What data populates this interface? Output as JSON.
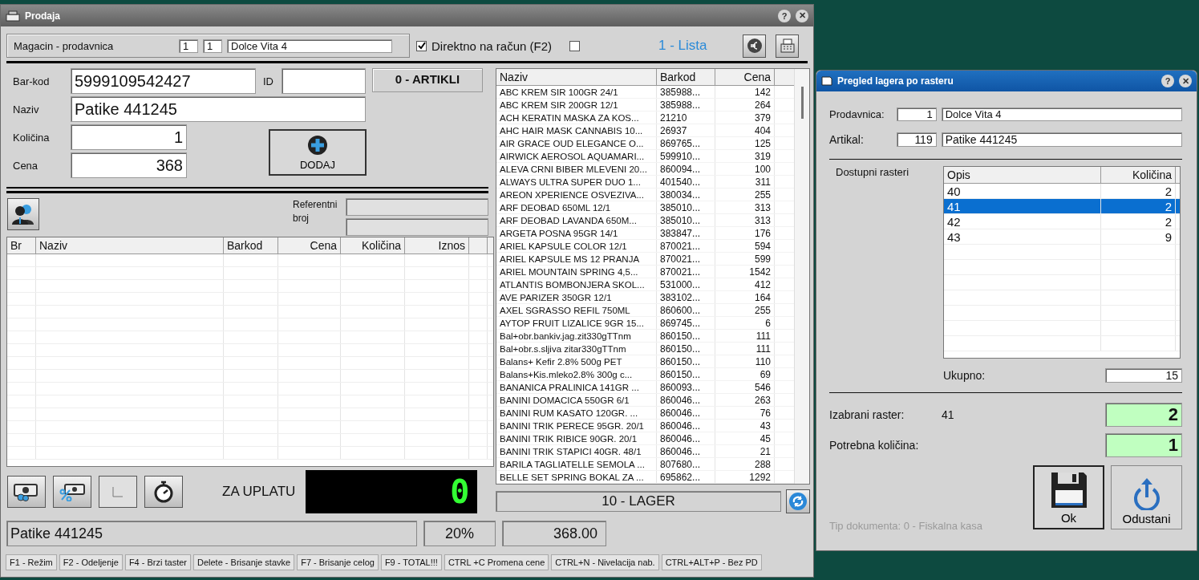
{
  "main_window": {
    "title": "Prodaja",
    "help": "?",
    "close": "✕"
  },
  "header": {
    "label": "Magacin - prodavnica",
    "field_1": "1",
    "field_2": "1",
    "store_name": "Dolce Vita 4",
    "direct_checkbox": {
      "label": "Direktno na račun (F2)",
      "checked": true
    },
    "extra_checkbox": {
      "checked": false
    },
    "list_label": "1 - Lista"
  },
  "form": {
    "barcode_label": "Bar-kod",
    "barcode": "5999109542427",
    "id_label": "ID",
    "article_count": "0 - ARTIKLI",
    "name_label": "Naziv",
    "name": "Patike 441245",
    "quantity_label": "Količina",
    "quantity": "1",
    "price_label": "Cena",
    "price": "368",
    "add_button": "DODAJ",
    "reference_label": "Referentni broj"
  },
  "cart": {
    "columns": [
      "Br",
      "Naziv",
      "Barkod",
      "Cena",
      "Količina",
      "Iznos"
    ]
  },
  "payment": {
    "label": "ZA UPLATU",
    "amount": "0"
  },
  "products": {
    "columns": [
      "Naziv",
      "Barkod",
      "Cena"
    ],
    "rows": [
      [
        "ABC KREM SIR 100GR 24/1",
        "385988...",
        "142"
      ],
      [
        "ABC KREM SIR 200GR 12/1",
        "385988...",
        "264"
      ],
      [
        "ACH KERATIN MASKA ZA KOS...",
        "21210",
        "379"
      ],
      [
        "AHC HAIR MASK CANNABIS 10...",
        "26937",
        "404"
      ],
      [
        "AIR GRACE OUD ELEGANCE O...",
        "869765...",
        "125"
      ],
      [
        "AIRWICK AEROSOL AQUAMARI...",
        "599910...",
        "319"
      ],
      [
        "ALEVA CRNI BIBER MLEVENI 20...",
        "860094...",
        "100"
      ],
      [
        "ALWAYS ULTRA SUPER DUO 1...",
        "401540...",
        "311"
      ],
      [
        "AREON XPERIENCE OSVEZIVA...",
        "380034...",
        "255"
      ],
      [
        "ARF DEOBAD 650ML 12/1",
        "385010...",
        "313"
      ],
      [
        "ARF DEOBAD LAVANDA 650M...",
        "385010...",
        "313"
      ],
      [
        "ARGETA POSNA 95GR 14/1",
        "383847...",
        "176"
      ],
      [
        "ARIEL KAPSULE COLOR 12/1",
        "870021...",
        "594"
      ],
      [
        "ARIEL KAPSULE MS 12 PRANJA",
        "870021...",
        "599"
      ],
      [
        "ARIEL MOUNTAIN SPRING 4,5...",
        "870021...",
        "1542"
      ],
      [
        "ATLANTIS BOMBONJERA SKOL...",
        "531000...",
        "412"
      ],
      [
        "AVE PARIZER 350GR 12/1",
        "383102...",
        "164"
      ],
      [
        "AXEL SGRASSO REFIL 750ML",
        "860600...",
        "255"
      ],
      [
        "AYTOP FRUIT LIZALICE 9GR 15...",
        "869745...",
        "6"
      ],
      [
        "Bal+obr.bankiv.jag.zit330gTTnm",
        "860150...",
        "111"
      ],
      [
        "Bal+obr.s.sljiva zitar330gTTnm",
        "860150...",
        "111"
      ],
      [
        "Balans+ Kefir 2.8% 500g PET",
        "860150...",
        "110"
      ],
      [
        "Balans+Kis.mleko2.8% 300g c...",
        "860150...",
        "69"
      ],
      [
        "BANANICA PRALINICA 141GR ...",
        "860093...",
        "546"
      ],
      [
        "BANINI DOMACICA 550GR 6/1",
        "860046...",
        "263"
      ],
      [
        "BANINI RUM KASATO 120GR. ...",
        "860046...",
        "76"
      ],
      [
        "BANINI TRIK PERECE 95GR. 20/1",
        "860046...",
        "43"
      ],
      [
        "BANINI TRIK RIBICE 90GR. 20/1",
        "860046...",
        "45"
      ],
      [
        "BANINI TRIK STAPICI 40GR. 48/1",
        "860046...",
        "21"
      ],
      [
        "BARILA TAGLIATELLE SEMOLA ...",
        "807680...",
        "288"
      ],
      [
        "BELLE SET SPRING BOKAL ZA ...",
        "695862...",
        "1292"
      ]
    ]
  },
  "stock_label": "10 - LAGER",
  "status_bar": {
    "item": "Patike 441245",
    "tax": "20%",
    "amount": "368.00"
  },
  "shortcuts": [
    "F1 - Režim",
    "F2 - Odeljenje",
    "F4 - Brzi taster",
    "Delete - Brisanje stavke",
    "F7 - Brisanje celog",
    "F9 - TOTAL!!!",
    "CTRL +C Promena cene",
    "CTRL+N - Nivelacija nab.",
    "CTRL+ALT+P - Bez PD"
  ],
  "dialog": {
    "title": "Pregled lagera po rasteru",
    "help": "?",
    "close": "✕",
    "store_label": "Prodavnica:",
    "store_id": "1",
    "store_name": "Dolce Vita 4",
    "article_label": "Artikal:",
    "article_id": "119",
    "article_name": "Patike 441245",
    "grid_label": "Dostupni rasteri",
    "columns": [
      "Opis",
      "Količina"
    ],
    "rows": [
      {
        "opis": "40",
        "kolicina": "2",
        "selected": false
      },
      {
        "opis": "41",
        "kolicina": "2",
        "selected": true
      },
      {
        "opis": "42",
        "kolicina": "2",
        "selected": false
      },
      {
        "opis": "43",
        "kolicina": "9",
        "selected": false
      }
    ],
    "total_label": "Ukupno:",
    "total": "15",
    "selected_label": "Izabrani raster:",
    "selected_value": "41",
    "selected_qty": "2",
    "needed_label": "Potrebna količina:",
    "needed_qty": "1",
    "ok_button": "Ok",
    "cancel_button": "Odustani",
    "doc_type": "Tip dokumenta:  0 - Fiskalna kasa"
  }
}
